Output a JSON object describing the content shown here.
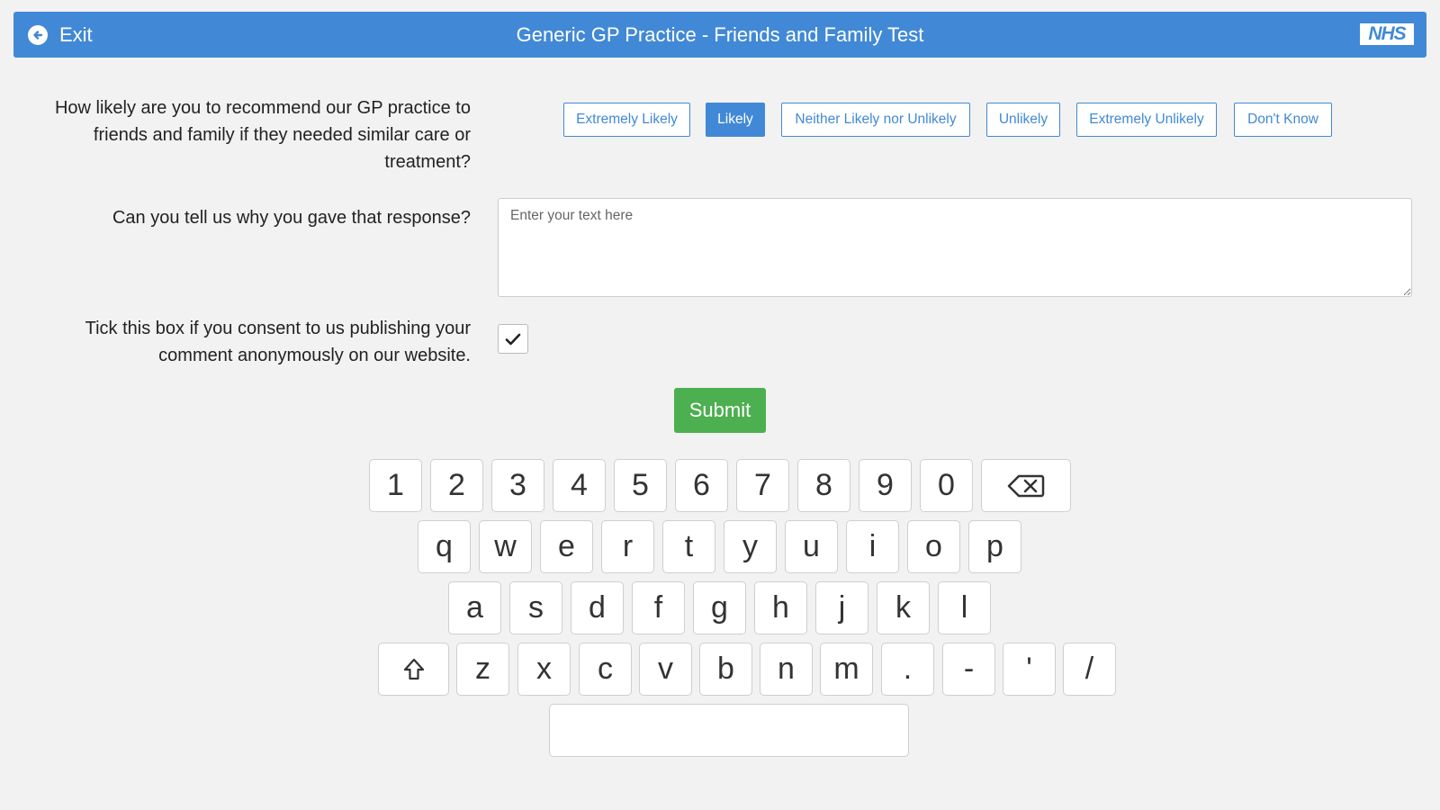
{
  "header": {
    "exit_label": "Exit",
    "exit_icon": "arrow-left-circle-icon",
    "title": "Generic GP Practice - Friends and Family Test",
    "logo_text": "NHS",
    "color": "#4189d6"
  },
  "questions": {
    "recommend": {
      "label": "How likely are you to recommend our GP practice to friends and family if they needed similar care or treatment?",
      "options": [
        "Extremely Likely",
        "Likely",
        "Neither Likely nor Unlikely",
        "Unlikely",
        "Extremely Unlikely",
        "Don't Know"
      ],
      "selected": "Likely"
    },
    "reason": {
      "label": "Can you tell us why you gave that response?",
      "placeholder": "Enter your text here",
      "value": ""
    },
    "consent": {
      "label": "Tick this box if you consent to us publishing your comment anonymously on our website.",
      "checked": true
    }
  },
  "submit_label": "Submit",
  "submit_color": "#4caf50",
  "keyboard": {
    "row1": [
      "1",
      "2",
      "3",
      "4",
      "5",
      "6",
      "7",
      "8",
      "9",
      "0"
    ],
    "row2": [
      "q",
      "w",
      "e",
      "r",
      "t",
      "y",
      "u",
      "i",
      "o",
      "p"
    ],
    "row3": [
      "a",
      "s",
      "d",
      "f",
      "g",
      "h",
      "j",
      "k",
      "l"
    ],
    "row4": [
      "z",
      "x",
      "c",
      "v",
      "b",
      "n",
      "m",
      ".",
      "-",
      "'",
      "/"
    ],
    "backspace_icon": "backspace-icon",
    "shift_icon": "shift-icon",
    "space_label": ""
  }
}
